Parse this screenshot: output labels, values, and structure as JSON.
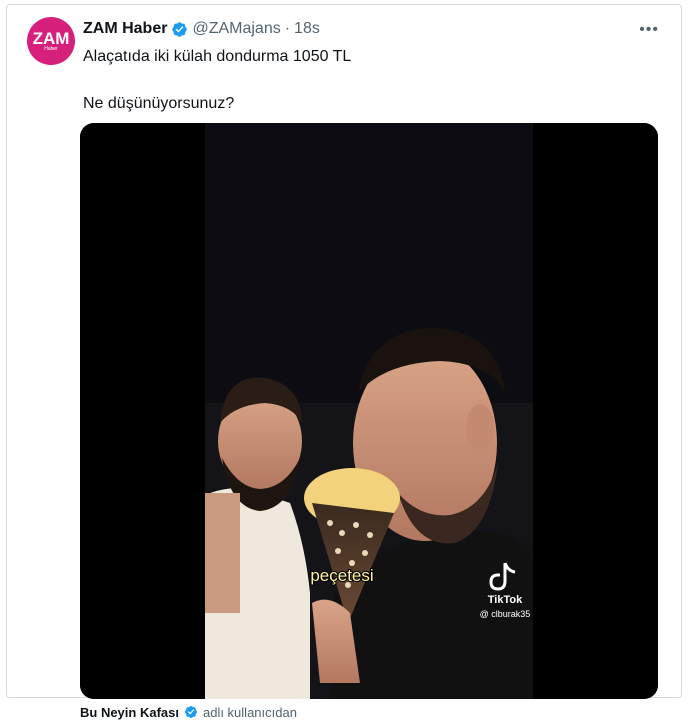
{
  "tweet": {
    "author_name": "ZAM Haber",
    "author_handle": "@ZAMajans",
    "separator": "·",
    "time": "18s",
    "more_label": "•••",
    "avatar_text": "ZAM",
    "avatar_subtext": "Haber",
    "text_line1": "Alaçatıda iki külah dondurma 1050 TL",
    "text_line2": "Ne düşünüyorsunuz?"
  },
  "video": {
    "caption": "peçetesi",
    "watermark_brand": "TikTok",
    "watermark_user": "@ clburak35"
  },
  "footer": {
    "source_name": "Bu Neyin Kafası",
    "via_text": "adlı kullanıcıdan"
  },
  "colors": {
    "brand": "#d6207c",
    "verified": "#1d9bf0",
    "muted": "#536471"
  },
  "icons": [
    "verified-badge-icon",
    "more-options-icon",
    "tiktok-logo-icon"
  ]
}
